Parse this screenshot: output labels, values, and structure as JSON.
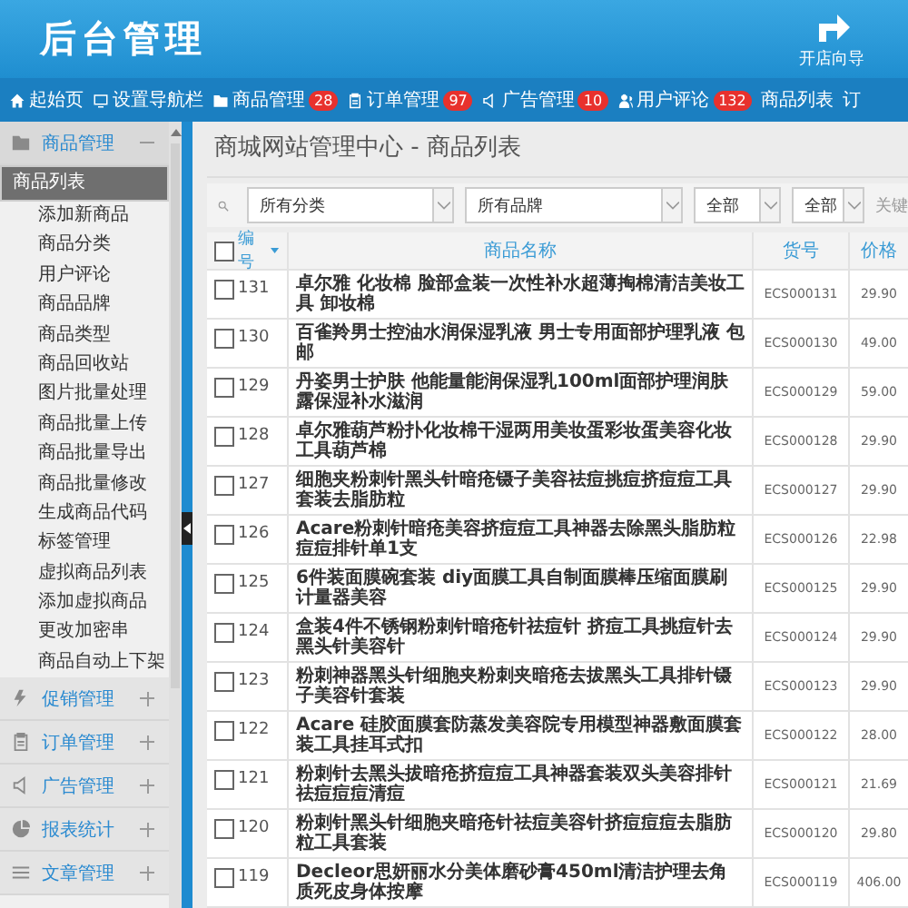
{
  "header": {
    "title": "后台管理",
    "guide_label": "开店向导"
  },
  "nav": [
    {
      "label": "起始页"
    },
    {
      "label": "设置导航栏"
    },
    {
      "label": "商品管理",
      "badge": "28"
    },
    {
      "label": "订单管理",
      "badge": "97"
    },
    {
      "label": "广告管理",
      "badge": "10"
    },
    {
      "label": "用户评论",
      "badge": "132"
    },
    {
      "label": "商品列表"
    },
    {
      "label": "订"
    }
  ],
  "sidebar": {
    "groups": [
      {
        "label": "商品管理",
        "expanded": true,
        "children": [
          {
            "label": "商品列表",
            "selected": true
          },
          {
            "label": "添加新商品",
            "selected": false
          },
          {
            "label": "商品分类",
            "selected": false
          },
          {
            "label": "用户评论",
            "selected": false
          },
          {
            "label": "商品品牌",
            "selected": false
          },
          {
            "label": "商品类型",
            "selected": false
          },
          {
            "label": "商品回收站",
            "selected": false
          },
          {
            "label": "图片批量处理",
            "selected": false
          },
          {
            "label": "商品批量上传",
            "selected": false
          },
          {
            "label": "商品批量导出",
            "selected": false
          },
          {
            "label": "商品批量修改",
            "selected": false
          },
          {
            "label": "生成商品代码",
            "selected": false
          },
          {
            "label": "标签管理",
            "selected": false
          },
          {
            "label": "虚拟商品列表",
            "selected": false
          },
          {
            "label": "添加虚拟商品",
            "selected": false
          },
          {
            "label": "更改加密串",
            "selected": false
          },
          {
            "label": "商品自动上下架",
            "selected": false
          }
        ]
      },
      {
        "label": "促销管理",
        "expanded": false
      },
      {
        "label": "订单管理",
        "expanded": false
      },
      {
        "label": "广告管理",
        "expanded": false
      },
      {
        "label": "报表统计",
        "expanded": false
      },
      {
        "label": "文章管理",
        "expanded": false
      }
    ]
  },
  "page_title": "商城网站管理中心 - 商品列表",
  "filters": {
    "selects": [
      "所有分类",
      "所有品牌",
      "全部",
      "全部"
    ],
    "keyword_label": "关键"
  },
  "table": {
    "columns": [
      "编号",
      "商品名称",
      "货号",
      "价格"
    ],
    "all_checked": false,
    "rows": [
      {
        "id": "131",
        "name": "卓尔雅 化妆棉 脸部盒装一次性补水超薄掏棉清洁美妆工具 卸妆棉",
        "sn": "ECS000131",
        "price": "29.90",
        "checked": false
      },
      {
        "id": "130",
        "name": "百雀羚男士控油水润保湿乳液 男士专用面部护理乳液 包邮",
        "sn": "ECS000130",
        "price": "49.00",
        "checked": false
      },
      {
        "id": "129",
        "name": "丹姿男士护肤 他能量能润保湿乳100ml面部护理润肤露保湿补水滋润",
        "sn": "ECS000129",
        "price": "59.00",
        "checked": false
      },
      {
        "id": "128",
        "name": "卓尔雅葫芦粉扑化妆棉干湿两用美妆蛋彩妆蛋美容化妆工具葫芦棉",
        "sn": "ECS000128",
        "price": "29.90",
        "checked": false
      },
      {
        "id": "127",
        "name": "细胞夹粉刺针黑头针暗疮镊子美容祛痘挑痘挤痘痘工具套装去脂肪粒",
        "sn": "ECS000127",
        "price": "29.90",
        "checked": false
      },
      {
        "id": "126",
        "name": "Acare粉刺针暗疮美容挤痘痘工具神器去除黑头脂肪粒痘痘排针单1支",
        "sn": "ECS000126",
        "price": "22.98",
        "checked": false
      },
      {
        "id": "125",
        "name": "6件装面膜碗套装 diy面膜工具自制面膜棒压缩面膜刷计量器美容",
        "sn": "ECS000125",
        "price": "29.90",
        "checked": false
      },
      {
        "id": "124",
        "name": "盒装4件不锈钢粉刺针暗疮针祛痘针 挤痘工具挑痘针去黑头针美容针",
        "sn": "ECS000124",
        "price": "29.90",
        "checked": false
      },
      {
        "id": "123",
        "name": "粉刺神器黑头针细胞夹粉刺夹暗疮去拔黑头工具排针镊子美容针套装",
        "sn": "ECS000123",
        "price": "29.90",
        "checked": false
      },
      {
        "id": "122",
        "name": "Acare 硅胶面膜套防蒸发美容院专用模型神器敷面膜套装工具挂耳式扣",
        "sn": "ECS000122",
        "price": "28.00",
        "checked": false
      },
      {
        "id": "121",
        "name": "粉刺针去黑头拔暗疮挤痘痘工具神器套装双头美容排针祛痘痘痘清痘",
        "sn": "ECS000121",
        "price": "21.69",
        "checked": false
      },
      {
        "id": "120",
        "name": "粉刺针黑头针细胞夹暗疮针祛痘美容针挤痘痘痘去脂肪粒工具套装",
        "sn": "ECS000120",
        "price": "29.80",
        "checked": false
      },
      {
        "id": "119",
        "name": "Decleor思妍丽水分美体磨砂膏450ml清洁护理去角质死皮身体按摩",
        "sn": "ECS000119",
        "price": "406.00",
        "checked": false
      }
    ]
  }
}
